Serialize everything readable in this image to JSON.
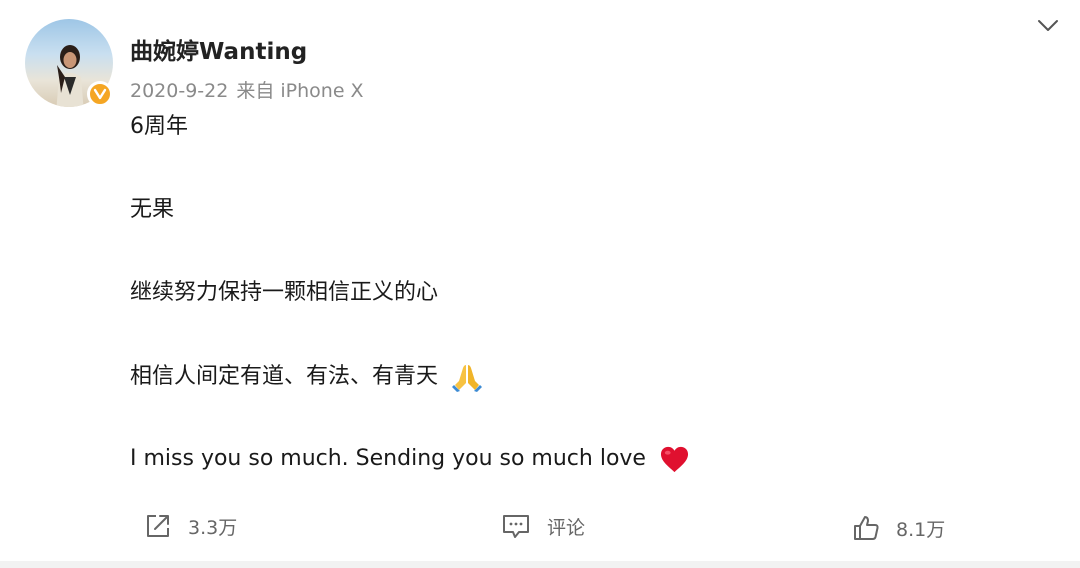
{
  "post": {
    "author": "曲婉婷Wanting",
    "date": "2020-9-22",
    "source": "来自 iPhone X",
    "lines": [
      "6周年",
      "无果",
      "继续努力保持一颗相信正义的心",
      "相信人间定有道、有法、有青天",
      "I miss you so much. Sending you so much love"
    ]
  },
  "actions": {
    "repost_count": "3.3万",
    "comment_label": "评论",
    "like_count": "8.1万"
  },
  "icons": {
    "verified": "verified-v-badge",
    "menu": "chevron-down-icon",
    "repost": "share-icon",
    "comment": "comment-icon",
    "like": "thumbs-up-icon",
    "pray": "folded-hands-emoji",
    "heart": "red-heart-emoji"
  },
  "colors": {
    "verified": "#f5a623",
    "meta_text": "#8a8a8a",
    "heart": "#e0102f"
  }
}
